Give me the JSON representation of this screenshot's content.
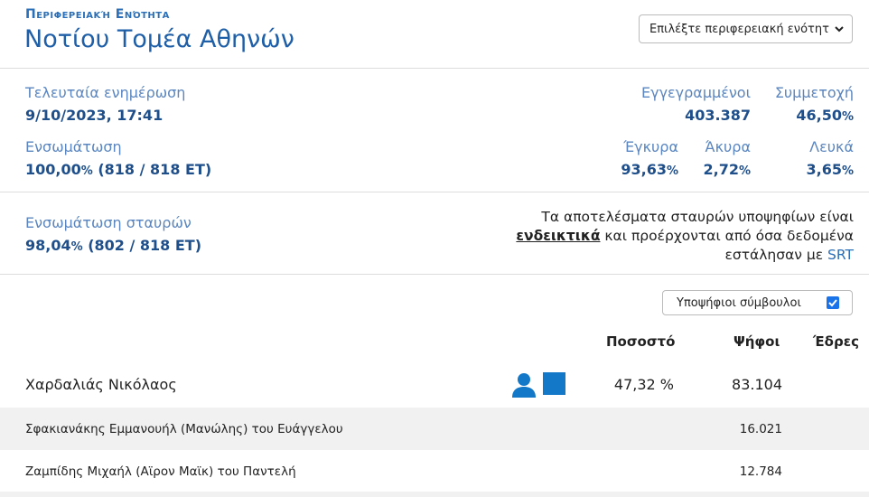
{
  "header": {
    "kicker": "Περιφερειακή Ενότητα",
    "title": "Νοτίου Τομέα Αθηνών",
    "select_label": "Επιλέξτε περιφερειακή ενότητ"
  },
  "stats": {
    "last_update_label": "Τελευταία ενημέρωση",
    "last_update_value": "9/10/2023, 17:41",
    "integration_label": "Ενσωμάτωση",
    "integration_pct": "100,00",
    "integration_rest": " (818 / 818 ΕΤ)",
    "registered_label": "Εγγεγραμμένοι",
    "registered_value": "403.387",
    "turnout_label": "Συμμετοχή",
    "turnout_value": "46,50",
    "valid_label": "Έγκυρα",
    "valid_value": "93,63",
    "invalid_label": "Άκυρα",
    "invalid_value": "2,72",
    "blank_label": "Λευκά",
    "blank_value": "3,65",
    "pct_sign": "%"
  },
  "cross": {
    "label": "Ενσωμάτωση σταυρών",
    "pct": "98,04",
    "rest": " (802 / 818 ΕΤ)",
    "note_line1": "Τα αποτελέσματα σταυρών υποψηφίων είναι",
    "note_indicative": "ενδεικτικά",
    "note_line2_rest": " και προέρχονται από όσα δεδομένα",
    "note_line3": "εστάλησαν με ",
    "note_srt": "SRT"
  },
  "toggle": {
    "label": "Υποψήφιοι σύμβουλοι",
    "checked": true
  },
  "table": {
    "col_percent": "Ποσοστό",
    "col_votes": "Ψήφοι",
    "col_seats": "Έδρες",
    "main": {
      "name": "Χαρδαλιάς Νικόλαος",
      "percent": "47,32 %",
      "votes": "83.104",
      "color": "#1478c8"
    },
    "subs": [
      {
        "name": "Σφακιανάκης Εμμανουήλ (Μανώλης) του Ευάγγελου",
        "votes": "16.021"
      },
      {
        "name": "Ζαμπίδης Μιχαήλ (Αϊρον Μαϊκ) του Παντελή",
        "votes": "12.784"
      }
    ]
  }
}
